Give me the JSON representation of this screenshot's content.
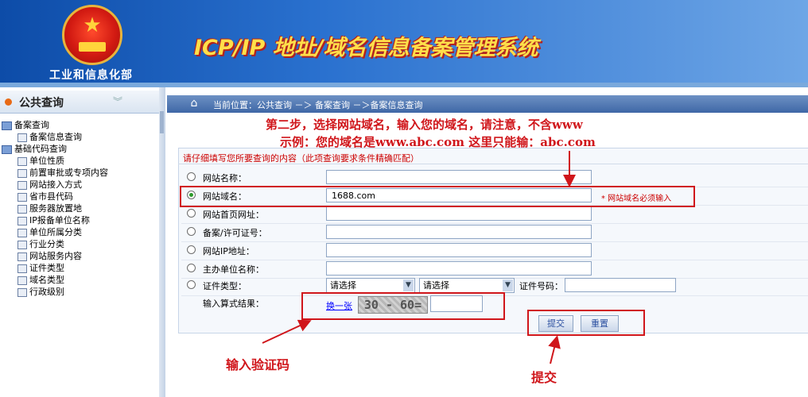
{
  "header": {
    "ministry": "工业和信息化部",
    "system_title": "ICP/IP 地址/域名信息备案管理系统"
  },
  "sidebar": {
    "title": "公共查询",
    "group1": {
      "label": "备案查询",
      "items": [
        "备案信息查询"
      ]
    },
    "group2": {
      "label": "基础代码查询",
      "items": [
        "单位性质",
        "前置审批或专项内容",
        "网站接入方式",
        "省市县代码",
        "服务器放置地",
        "IP报备单位名称",
        "单位所属分类",
        "行业分类",
        "网站服务内容",
        "证件类型",
        "域名类型",
        "行政级别"
      ]
    }
  },
  "breadcrumb": {
    "text": "当前位置：公共查询 －＞ 备案查询 －＞备案信息查询"
  },
  "form": {
    "instruction": "请仔细填写您所要查询的内容（此项查询要求条件精确匹配）",
    "rows": [
      {
        "label": "网站名称：",
        "value": "",
        "selected": false
      },
      {
        "label": "网站域名：",
        "value": "1688.com",
        "selected": true
      },
      {
        "label": "网站首页网址：",
        "value": "",
        "selected": false
      },
      {
        "label": "备案/许可证号：",
        "value": "",
        "selected": false
      },
      {
        "label": "网站IP地址：",
        "value": "",
        "selected": false
      },
      {
        "label": "主办单位名称：",
        "value": "",
        "selected": false
      }
    ],
    "cert_type_label": "证件类型：",
    "select1": "请选择",
    "select2": "请选择",
    "cert_no_label": "证件号码：",
    "required_note": "* 网站域名必须输入",
    "captcha_label": "输入算式结果：",
    "captcha_refresh": "换一张",
    "captcha_text": "30 - 60=",
    "submit": "提交",
    "reset": "重置"
  },
  "annotations": {
    "step_line1": "第二步，选择网站域名，输入您的域名，请注意，不含www",
    "step_line2": "示例：您的域名是www.abc.com 这里只能输：abc.com",
    "captcha_note": "输入验证码",
    "submit_note": "提交"
  },
  "colors": {
    "annotation": "#d0161b",
    "header": "#2a71cf",
    "title_yellow": "#ffdf4a"
  }
}
